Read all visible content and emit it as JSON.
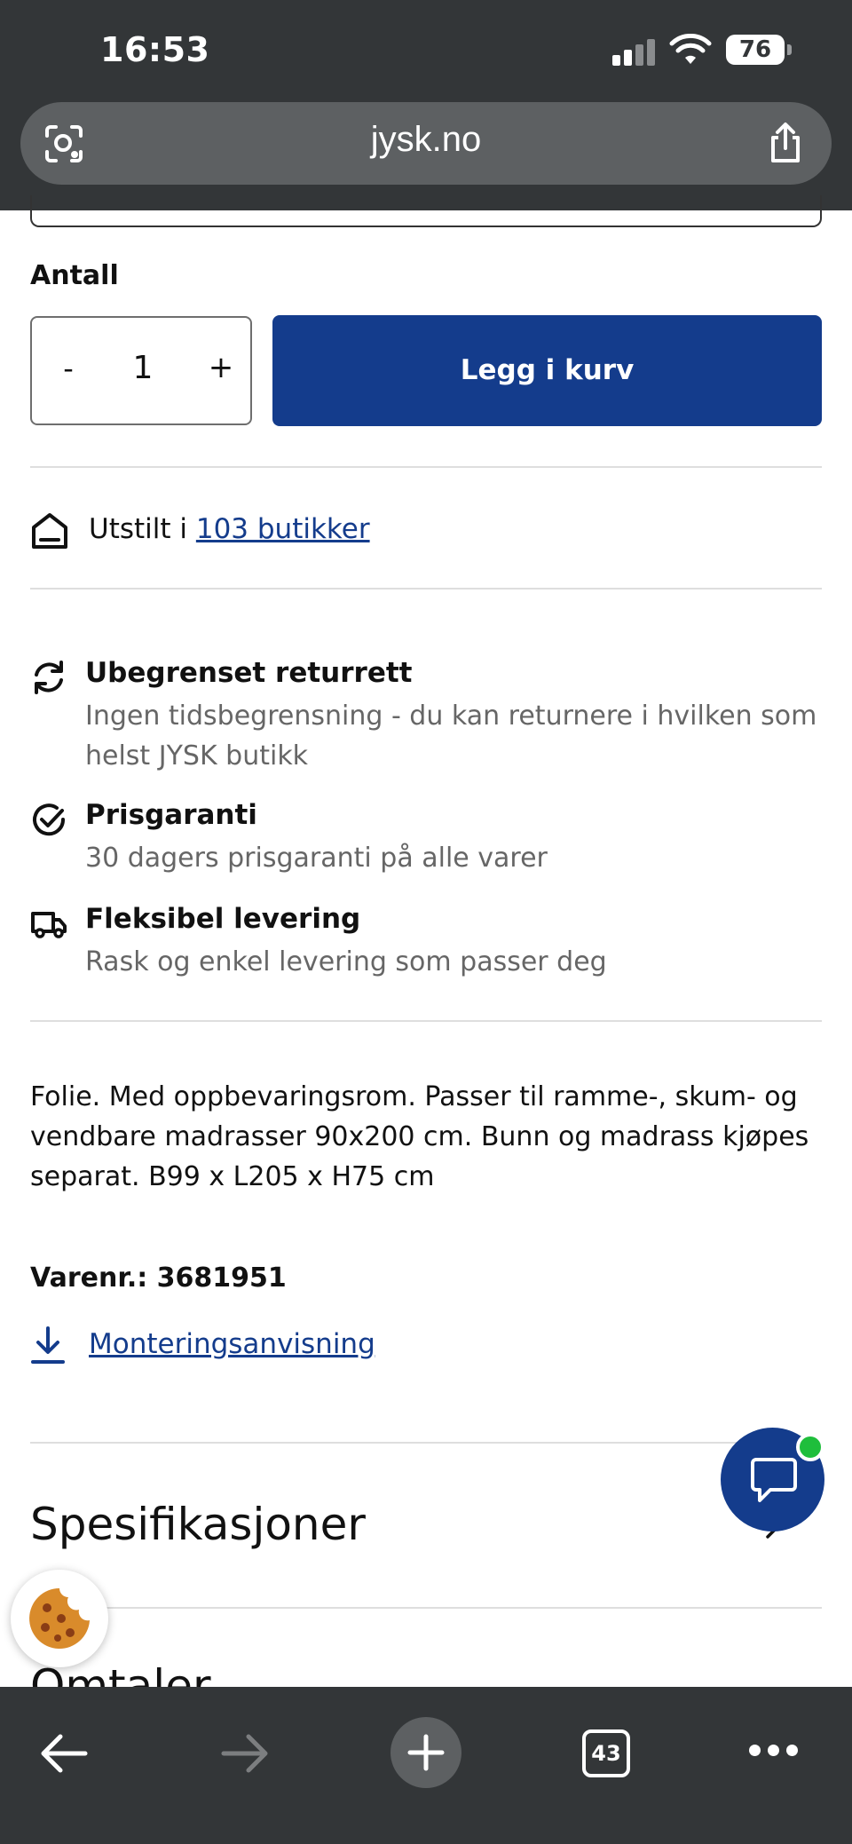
{
  "status_bar": {
    "time": "16:53",
    "battery": "76"
  },
  "browser": {
    "url": "jysk.no",
    "tab_count": "43"
  },
  "product": {
    "quantity_label": "Antall",
    "quantity": {
      "minus": "-",
      "value": "1",
      "plus": "+"
    },
    "add_to_cart_label": "Legg i kurv",
    "store_prefix": "Utstilt i ",
    "store_link": "103 butikker",
    "usps": [
      {
        "title": "Ubegrenset returrett",
        "desc": "Ingen tidsbegrensning - du kan returnere i hvilken som helst JYSK butikk"
      },
      {
        "title": "Prisgaranti",
        "desc": "30 dagers prisgaranti på alle varer"
      },
      {
        "title": "Fleksibel levering",
        "desc": "Rask og enkel levering som passer deg"
      }
    ],
    "description": "Folie. Med oppbevaringsrom. Passer til ramme-, skum- og vendbare madrasser 90x200 cm. Bunn og madrass kjøpes separat. B99 x L205 x H75 cm",
    "sku": "Varenr.: 3681951",
    "manual_link": "Monteringsanvisning"
  },
  "sections": {
    "specifications": "Spesifikasjoner",
    "reviews": "Omtaler"
  },
  "colors": {
    "brand_blue": "#143c8c",
    "chat_online": "#1fbe3c",
    "chrome_dark": "#333638"
  },
  "icons": {
    "lens": "camera-lens-icon",
    "share": "share-icon",
    "store": "store-icon",
    "returns": "refresh-icon",
    "price": "check-circle-icon",
    "delivery": "truck-icon",
    "download": "download-icon",
    "chat": "chat-bubble-icon",
    "cookie": "cookie-icon",
    "back": "arrow-left-icon",
    "forward": "arrow-right-icon",
    "new_tab": "plus-icon",
    "more": "more-dots-icon"
  }
}
